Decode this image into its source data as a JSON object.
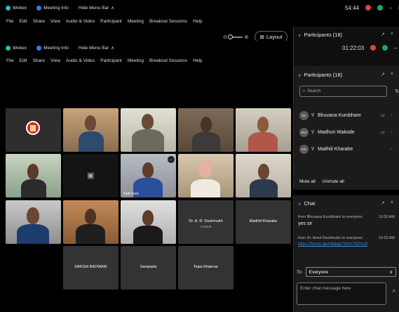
{
  "window_top": {
    "app": "Webex",
    "meeting_info": "Meeting Info",
    "hide_menu": "Hide Menu Bar",
    "timer": "54:44",
    "minimize": "–",
    "restore": "□",
    "close": "×"
  },
  "menu_top": [
    "File",
    "Edit",
    "Share",
    "View",
    "Audio & Video",
    "Participant",
    "Meeting",
    "Breakout Sessions",
    "Help"
  ],
  "window_inner": {
    "app": "Webex",
    "meeting_info": "Meeting Info",
    "hide_menu": "Hide Menu Bar",
    "timer": "01:22:03"
  },
  "menu_inner": [
    "File",
    "Edit",
    "Share",
    "View",
    "Audio & Video",
    "Participant",
    "Meeting",
    "Breakout Sessions",
    "Help"
  ],
  "layout": {
    "label": "Layout"
  },
  "participants_outer": {
    "title": "Participants (18)"
  },
  "participants": {
    "title": "Participants (18)",
    "search_placeholder": "Search",
    "list": [
      {
        "initials": "BK",
        "name": "Bhuvana Kumbhare"
      },
      {
        "initials": "MW",
        "name": "Madhuri Wakode"
      },
      {
        "initials": "MK",
        "name": "Maithili Kharabe"
      }
    ],
    "mute_all": "Mute all",
    "unmute_all": "Unmute all"
  },
  "chat": {
    "title": "Chat",
    "messages": [
      {
        "from": "from Bhuvana Kumbhare to everyone:",
        "time": "10:30 AM",
        "text": "yes sir"
      },
      {
        "from": "from Dr. Amol Deshmukh to everyone:",
        "time": "10:33 AM",
        "link": "https://forms.gle/nfqbgk7NYn7GPnz5"
      }
    ],
    "to_label": "To:",
    "to_value": "Everyone",
    "input_placeholder": "Enter chat message here"
  },
  "tiles": {
    "tile_small_name": "Deti Ison",
    "ar_name": "Dr. A. R. Deshmukh",
    "ar_sub": "Consult",
    "maithili": "Maithili Kharabe",
    "sakshi": "SAKSHI BADWAIK",
    "sampada": "Sampada",
    "tejas": "Tejas Khairnar"
  }
}
